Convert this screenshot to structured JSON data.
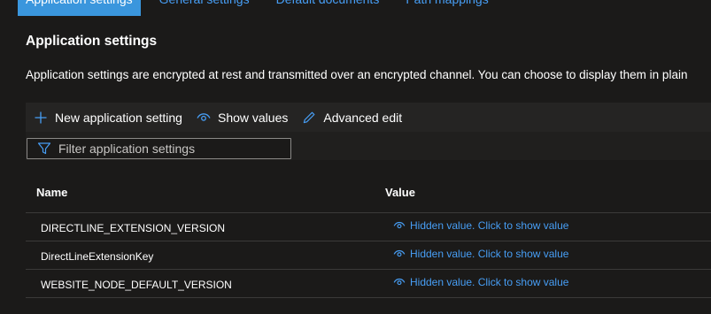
{
  "tabs": [
    {
      "label": "Application settings",
      "active": true
    },
    {
      "label": "General settings",
      "active": false
    },
    {
      "label": "Default documents",
      "active": false
    },
    {
      "label": "Path mappings",
      "active": false
    }
  ],
  "section": {
    "title": "Application settings",
    "description": "Application settings are encrypted at rest and transmitted over an encrypted channel. You can choose to display them in plain"
  },
  "toolbar": {
    "new_label": "New application setting",
    "show_values_label": "Show values",
    "advanced_edit_label": "Advanced edit"
  },
  "filter": {
    "placeholder": "Filter application settings",
    "value": ""
  },
  "table": {
    "columns": [
      "Name",
      "Value"
    ],
    "rows": [
      {
        "name": "DIRECTLINE_EXTENSION_VERSION",
        "value": "Hidden value. Click to show value"
      },
      {
        "name": "DirectLineExtensionKey",
        "value": "Hidden value. Click to show value"
      },
      {
        "name": "WEBSITE_NODE_DEFAULT_VERSION",
        "value": "Hidden value. Click to show value"
      }
    ]
  },
  "icons": {
    "add": "plus-icon",
    "show": "eye-icon",
    "edit": "pencil-icon",
    "filter": "filter-icon"
  },
  "colors": {
    "accent": "#479ef5",
    "active_tab": "#3a96dd",
    "background": "#1b1a19",
    "toolbar": "#252423"
  }
}
